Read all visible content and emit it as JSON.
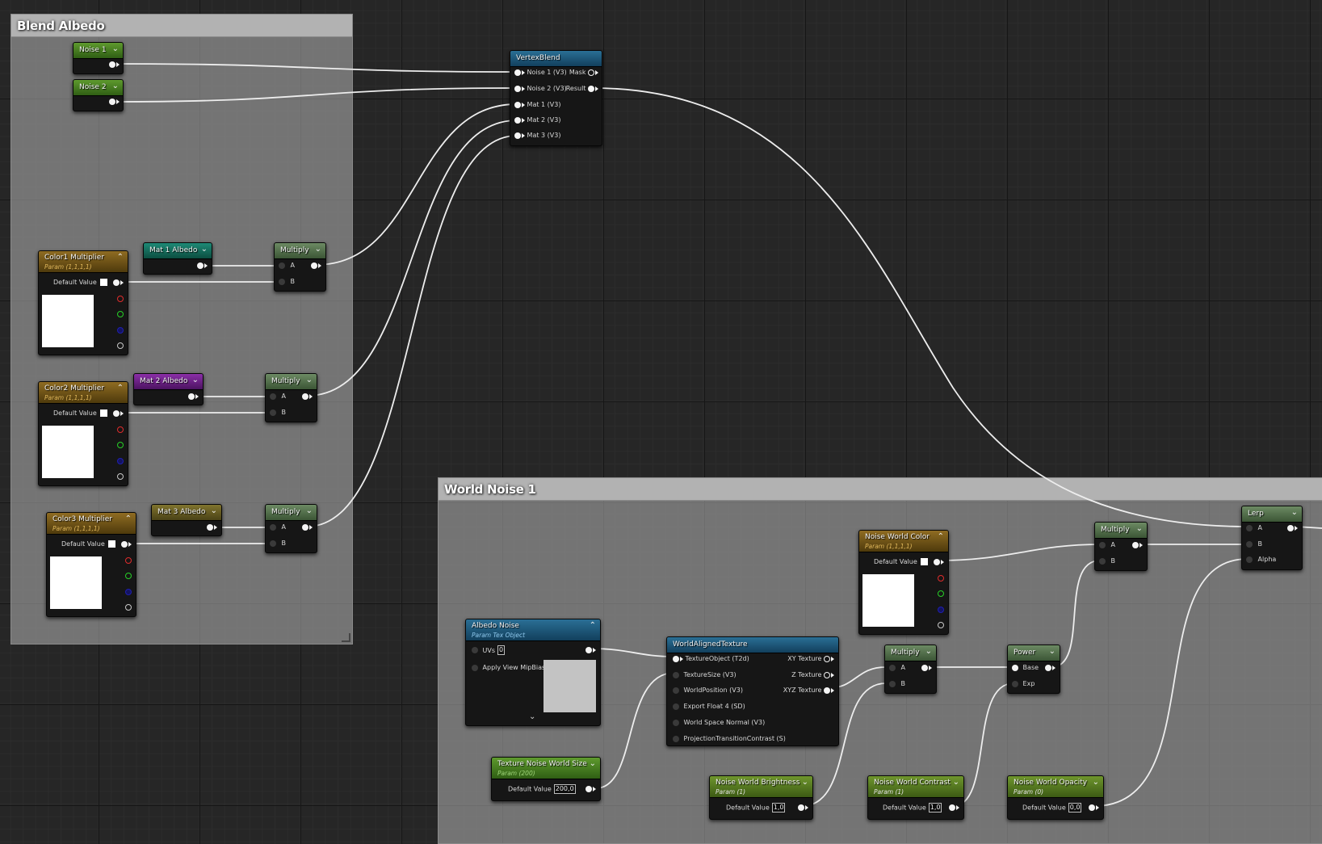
{
  "comments": {
    "blend_albedo": "Blend Albedo",
    "world_noise": "World Noise 1"
  },
  "nodes": {
    "noise1": {
      "title": "Noise 1"
    },
    "noise2": {
      "title": "Noise 2"
    },
    "vertexblend": {
      "title": "VertexBlend",
      "inputs": [
        "Noise 1 (V3)",
        "Noise 2 (V3)",
        "Mat 1 (V3)",
        "Mat 2 (V3)",
        "Mat 3 (V3)"
      ],
      "outputs": [
        "Mask",
        "Result"
      ]
    },
    "color1": {
      "title": "Color1 Multiplier",
      "subtitle": "Param (1,1,1,1)",
      "default_label": "Default Value"
    },
    "color2": {
      "title": "Color2 Multiplier",
      "subtitle": "Param (1,1,1,1)",
      "default_label": "Default Value"
    },
    "color3": {
      "title": "Color3 Multiplier",
      "subtitle": "Param (1,1,1,1)",
      "default_label": "Default Value"
    },
    "mat1": {
      "title": "Mat 1 Albedo"
    },
    "mat2": {
      "title": "Mat 2 Albedo"
    },
    "mat3": {
      "title": "Mat 3 Albedo"
    },
    "multiply1": {
      "title": "Multiply",
      "a": "A",
      "b": "B"
    },
    "multiply2": {
      "title": "Multiply",
      "a": "A",
      "b": "B"
    },
    "multiply3": {
      "title": "Multiply",
      "a": "A",
      "b": "B"
    },
    "albedo_noise": {
      "title": "Albedo Noise",
      "subtitle": "Param Tex Object",
      "uvs_label": "UVs",
      "uvs_value": "0",
      "mip_label": "Apply View MipBias"
    },
    "texture_noise_size": {
      "title": "Texture Noise World Size",
      "subtitle": "Param (200)",
      "default_label": "Default Value",
      "value": "200,0"
    },
    "world_aligned": {
      "title": "WorldAlignedTexture",
      "inputs": [
        "TextureObject (T2d)",
        "TextureSize (V3)",
        "WorldPosition (V3)",
        "Export Float 4 (SD)",
        "World Space Normal (V3)",
        "ProjectionTransitionContrast (S)"
      ],
      "outputs": [
        "XY Texture",
        "Z Texture",
        "XYZ Texture"
      ]
    },
    "noise_brightness": {
      "title": "Noise World Brightness",
      "subtitle": "Param (1)",
      "default_label": "Default Value",
      "value": "1,0"
    },
    "multiply4": {
      "title": "Multiply",
      "a": "A",
      "b": "B"
    },
    "noise_color": {
      "title": "Noise World Color",
      "subtitle": "Param (1,1,1,1)",
      "default_label": "Default Value"
    },
    "noise_contrast": {
      "title": "Noise World Contrast",
      "subtitle": "Param (1)",
      "default_label": "Default Value",
      "value": "1,0"
    },
    "power": {
      "title": "Power",
      "base": "Base",
      "exp": "Exp"
    },
    "multiply5": {
      "title": "Multiply",
      "a": "A",
      "b": "B"
    },
    "noise_opacity": {
      "title": "Noise World Opacity",
      "subtitle": "Param (0)",
      "default_label": "Default Value",
      "value": "0,0"
    },
    "lerp": {
      "title": "Lerp",
      "a": "A",
      "b": "B",
      "alpha": "Alpha"
    }
  },
  "colors": {
    "graph_bg": "#262626",
    "wire": "#ededed",
    "comment_bg": "#a8a8a8",
    "scalar_param": "#5e9a2e",
    "vector_param": "#8f6c22",
    "texture_param": "#2a6f95",
    "mat1_albedo": "#1e8a76",
    "mat2_albedo": "#8b2fa8",
    "mat3_albedo": "#80742e"
  }
}
